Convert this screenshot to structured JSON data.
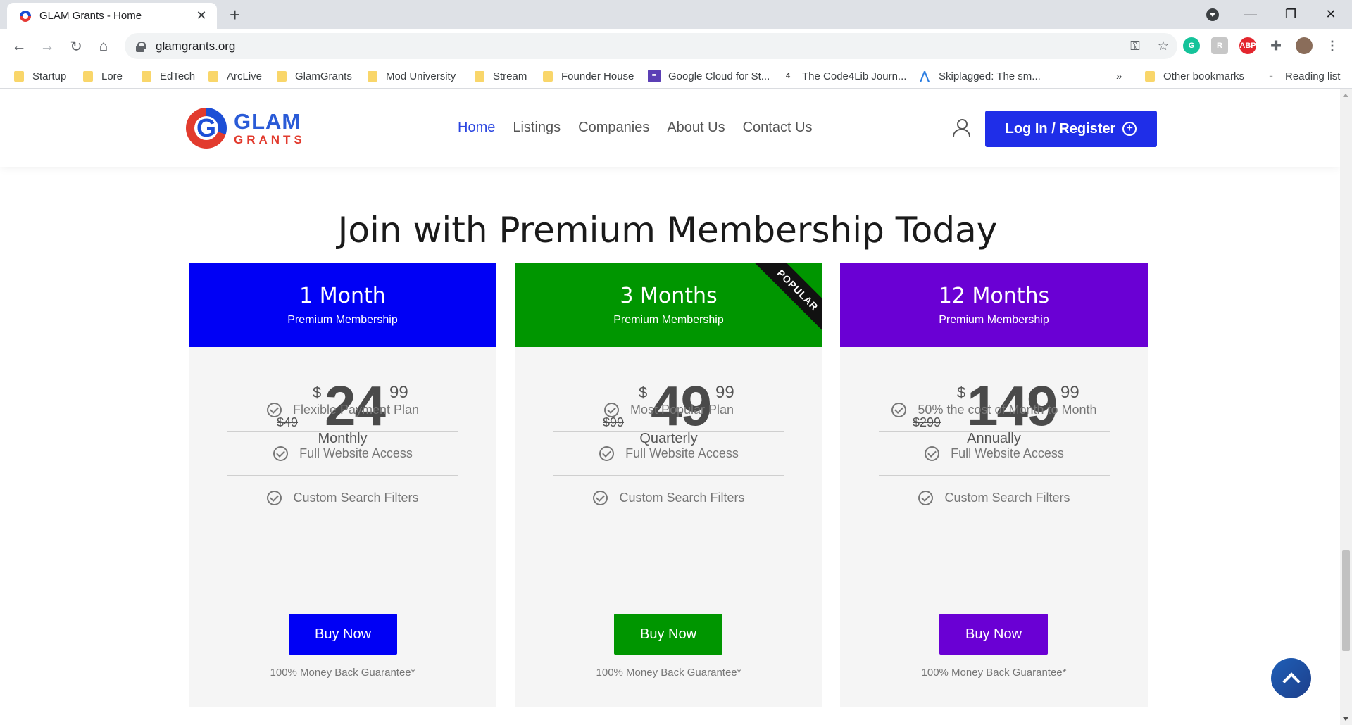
{
  "browser": {
    "tab_title": "GLAM Grants - Home",
    "url": "glamgrants.org",
    "bookmarks": [
      {
        "label": "Startup",
        "icon": "folder-icon"
      },
      {
        "label": "Lore",
        "icon": "folder-icon"
      },
      {
        "label": "EdTech",
        "icon": "folder-icon"
      },
      {
        "label": "ArcLive",
        "icon": "folder-icon"
      },
      {
        "label": "GlamGrants",
        "icon": "folder-icon"
      },
      {
        "label": "Mod University",
        "icon": "folder-icon"
      },
      {
        "label": "Stream",
        "icon": "folder-icon"
      },
      {
        "label": "Founder House",
        "icon": "folder-icon"
      },
      {
        "label": "Google Cloud for St...",
        "icon": "google-cloud-icon"
      },
      {
        "label": "The Code4Lib Journ...",
        "icon": "code4lib-icon"
      },
      {
        "label": "Skiplagged: The sm...",
        "icon": "skiplagged-icon"
      }
    ],
    "overflow_label": "»",
    "other_bookmarks": "Other bookmarks",
    "reading_list": "Reading list"
  },
  "site": {
    "logo": {
      "line1": "GLAM",
      "line2": "GRANTS"
    },
    "nav": [
      {
        "label": "Home",
        "active": true
      },
      {
        "label": "Listings",
        "active": false
      },
      {
        "label": "Companies",
        "active": false
      },
      {
        "label": "About Us",
        "active": false
      },
      {
        "label": "Contact Us",
        "active": false
      }
    ],
    "login_label": "Log In / Register"
  },
  "pricing": {
    "headline": "Join with Premium Membership Today",
    "plans": [
      {
        "name": "1 Month",
        "subtitle": "Premium Membership",
        "color": "#0000f5",
        "old_price": "$49",
        "currency": "$",
        "amount": "24",
        "cents": "99",
        "period": "Monthly",
        "features": [
          "Flexible Payment Plan",
          "Full Website Access",
          "Custom Search Filters"
        ],
        "button": "Buy Now",
        "guarantee": "100% Money Back Guarantee*"
      },
      {
        "name": "3 Months",
        "subtitle": "Premium Membership",
        "color": "#009600",
        "ribbon": "POPULAR",
        "old_price": "$99",
        "currency": "$",
        "amount": "49",
        "cents": "99",
        "period": "Quarterly",
        "features": [
          "Most Popular Plan",
          "Full Website Access",
          "Custom Search Filters"
        ],
        "button": "Buy Now",
        "guarantee": "100% Money Back Guarantee*"
      },
      {
        "name": "12 Months",
        "subtitle": "Premium Membership",
        "color": "#6a00d4",
        "old_price": "$299",
        "currency": "$",
        "amount": "149",
        "cents": "99",
        "period": "Annually",
        "features": [
          "50% the cost of Month to Month",
          "Full Website Access",
          "Custom Search Filters"
        ],
        "button": "Buy Now",
        "guarantee": "100% Money Back Guarantee*"
      }
    ]
  }
}
